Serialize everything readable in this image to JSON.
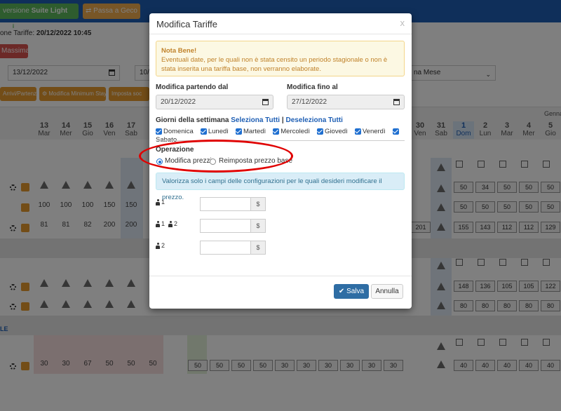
{
  "topbar": {
    "version_prefix": "versione",
    "version_name": "Suite Light",
    "geco_button": "⇄ Passa a Geco"
  },
  "page": {
    "update_label": "one Tariffe:",
    "update_value": "20/12/2022 10:45",
    "max_button": "Massima",
    "date_from": "13/12/2022",
    "date_partial": "10/0",
    "period_select": "na Mese",
    "btn_arrivi": "Arrivi/Partenza",
    "btn_min_stay": "⚙ Modifica Minimum Stay",
    "btn_imposta": "Imposta soc",
    "month_label": "Genna",
    "days": [
      {
        "num": "13",
        "name": "Mar"
      },
      {
        "num": "14",
        "name": "Mer"
      },
      {
        "num": "15",
        "name": "Gio"
      },
      {
        "num": "16",
        "name": "Ven"
      },
      {
        "num": "17",
        "name": "Sab"
      }
    ],
    "days_right": [
      {
        "num": "30",
        "name": "Ven"
      },
      {
        "num": "31",
        "name": "Sab"
      },
      {
        "num": "1",
        "name": "Dom"
      },
      {
        "num": "2",
        "name": "Lun"
      },
      {
        "num": "3",
        "name": "Mar"
      },
      {
        "num": "4",
        "name": "Mer"
      },
      {
        "num": "5",
        "name": "Gio"
      }
    ],
    "row_values_a": [
      "100",
      "100",
      "100",
      "150",
      "150"
    ],
    "row_values_b": [
      "81",
      "81",
      "82",
      "200",
      "200"
    ],
    "row_right_a": [
      "50",
      "34",
      "50",
      "50",
      "50"
    ],
    "row_right_b": [
      "50",
      "50",
      "50",
      "50",
      "50"
    ],
    "row_right_c": [
      "155",
      "143",
      "112",
      "112",
      "129"
    ],
    "row_right_d": [
      "148",
      "136",
      "105",
      "105",
      "122"
    ],
    "row_right_e": [
      "80",
      "80",
      "80",
      "80",
      "80"
    ],
    "right_c_first": "201",
    "bottom_values": [
      "30",
      "30",
      "67",
      "50",
      "50",
      "50"
    ],
    "bottom_inputs": [
      "50",
      "50",
      "50",
      "50",
      "30",
      "30",
      "30",
      "30",
      "30",
      "30",
      "40",
      "40",
      "40",
      "40",
      "40"
    ],
    "section_letter": "LE"
  },
  "modal": {
    "title": "Modifica Tariffe",
    "close": "x",
    "note_title": "Nota Bene!",
    "note_text": "Eventuali date, per le quali non è stata censito un periodo stagionale o non è stata inserita una tariffa base, non verranno elaborate.",
    "from_label": "Modifica partendo dal",
    "from_value": "20/12/2022",
    "to_label": "Modifica fino al",
    "to_value": "27/12/2022",
    "days_label": "Giorni della settimana",
    "select_all": "Seleziona Tutti",
    "separator": "|",
    "deselect_all": "Deseleziona Tutti",
    "weekdays": [
      "Domenica",
      "Lunedì",
      "Martedì",
      "Mercoledì",
      "Giovedì",
      "Venerdì",
      "Sabato"
    ],
    "operation_label": "Operazione",
    "option_modify": "Modifica prezzi",
    "option_reset": "Reimposta prezzo base",
    "info_text": "Valorizza solo i campi delle configurazioni per le quali desideri modificare il prezzo.",
    "occupancy": [
      {
        "label": "1",
        "currency": "$"
      },
      {
        "label": "1",
        "label2": "2",
        "currency": "$"
      },
      {
        "label": "2",
        "currency": "$"
      }
    ],
    "save_label": "Salva",
    "cancel_label": "Annulla"
  },
  "colors": {
    "primary": "#2e6da4",
    "warning_bg": "#fcf8e3",
    "info_bg": "#d9edf7",
    "highlight": "#e00000"
  }
}
